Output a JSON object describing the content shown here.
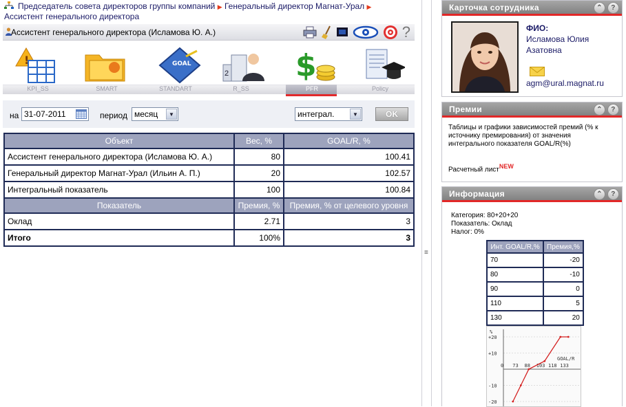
{
  "breadcrumb": {
    "items": [
      "Председатель совета директоров группы компаний",
      "Генеральный директор Магнат-Урал",
      "Ассистент генерального директора"
    ]
  },
  "title": "Ассистент генерального директора  (Исламова Ю. А.)",
  "toolbar": {
    "icons": [
      "printer-icon",
      "broom-icon",
      "monitor-icon",
      "eye-icon",
      "target-icon",
      "help-icon"
    ],
    "help_label": "?"
  },
  "modules": [
    "KPI_SS",
    "SMART",
    "STANDART",
    "R_SS",
    "PFR",
    "Policy"
  ],
  "active_module": "PFR",
  "form": {
    "date_label": "на",
    "date_value": "31-07-2011",
    "period_label": "период",
    "period_value": "месяц",
    "type_value": "интеграл.",
    "ok_label": "OK"
  },
  "table": {
    "header1": [
      "Объект",
      "Вес, %",
      "GOAL/R, %"
    ],
    "rows1": [
      [
        "Ассистент генерального директора (Исламова Ю. А.)",
        "80",
        "100.41"
      ],
      [
        "Генеральный директор Магнат-Урал (Ильин А. П.)",
        "20",
        "102.57"
      ],
      [
        "Интегральный показатель",
        "100",
        "100.84"
      ]
    ],
    "header2": [
      "Показатель",
      "Премия, %",
      "Премия, % от целевого уровня"
    ],
    "rows2": [
      [
        "Оклад",
        "2.71",
        "3"
      ]
    ],
    "total": [
      "Итого",
      "100%",
      "3"
    ]
  },
  "card": {
    "title": "Карточка сотрудника",
    "fio_label": "ФИО:",
    "name_line1": "Исламова Юлия",
    "name_line2": "Азатовна",
    "email": "agm@ural.magnat.ru"
  },
  "bonus": {
    "title": "Премии",
    "text": "Таблицы и графики зависимостей премий (% к источнику премирования) от значения интегрального показателя GOAL/R(%)",
    "link": "Расчетный лист",
    "badge": "NEW"
  },
  "info": {
    "title": "Информация",
    "category": "Категория: 80+20+20",
    "indicator": "Показатель: Оклад",
    "tax": "Налог: 0%",
    "table_header": [
      "Инт. GOAL/R,%",
      "Премия,%"
    ],
    "table_rows": [
      [
        "70",
        "-20"
      ],
      [
        "80",
        "-10"
      ],
      [
        "90",
        "0"
      ],
      [
        "110",
        "5"
      ],
      [
        "130",
        "20"
      ]
    ]
  },
  "chart_data": {
    "type": "line",
    "ylabel": "%",
    "xlabel": "GOAL/R",
    "x_ticks": [
      "0",
      "73",
      "88",
      "103",
      "118",
      "133"
    ],
    "y_ticks": [
      "+20",
      "+10",
      "-10",
      "-20"
    ],
    "series": [
      {
        "x": [
          70,
          80,
          90,
          110,
          130,
          140
        ],
        "values": [
          -20,
          -10,
          0,
          5,
          20,
          20
        ]
      }
    ],
    "colors": {
      "line": "#d42020"
    }
  },
  "colors": {
    "accent": "#e22727",
    "header": "#9da3bd",
    "border": "#1e2a55"
  }
}
